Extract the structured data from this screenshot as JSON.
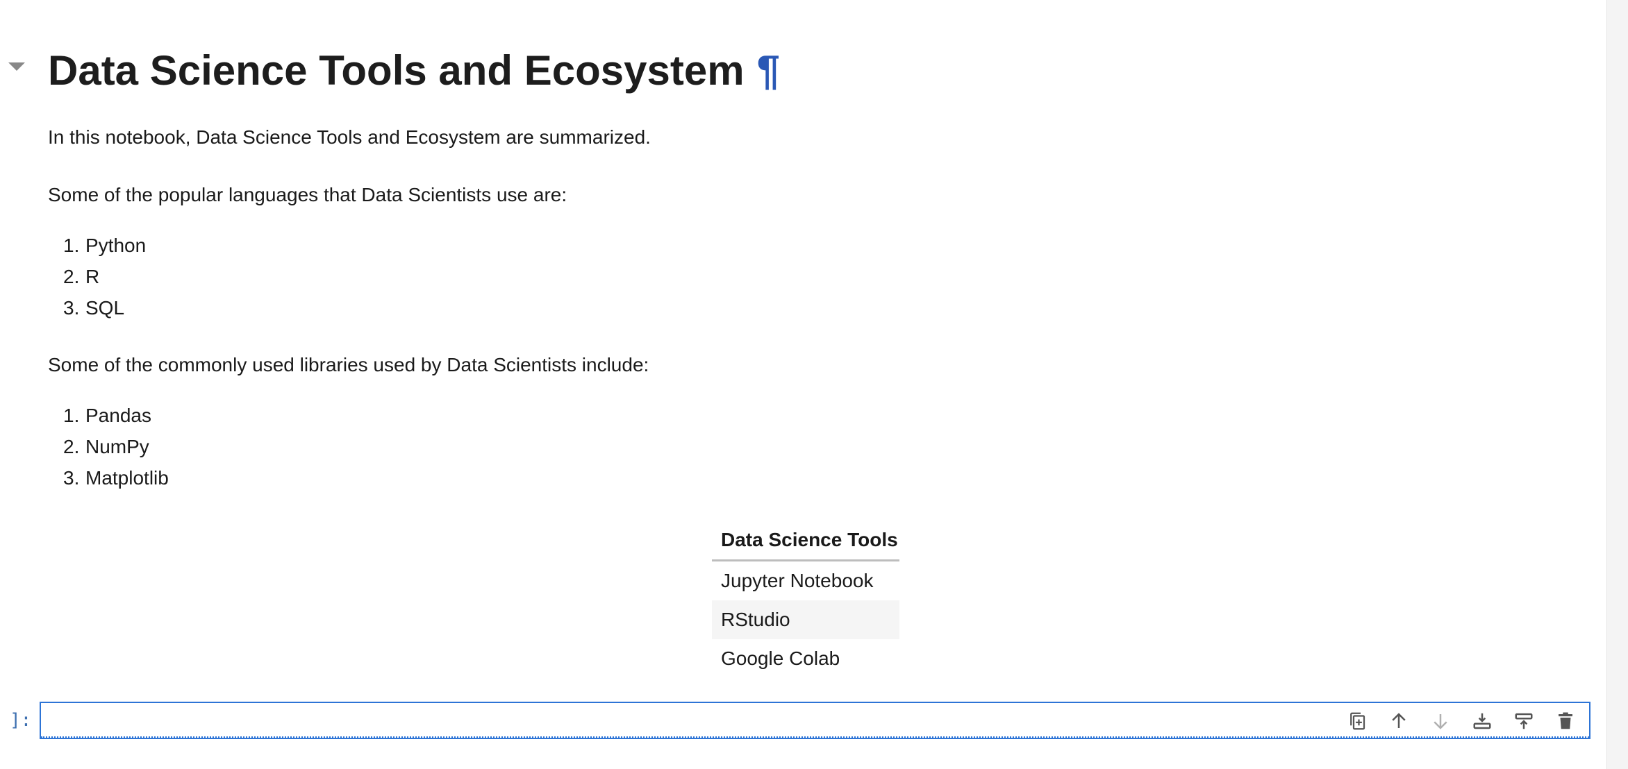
{
  "notebook": {
    "heading": {
      "text": "Data Science Tools and Ecosystem",
      "anchor": "¶"
    },
    "intro": "In this notebook, Data Science Tools and Ecosystem are summarized.",
    "languages_intro": "Some of the popular languages that Data Scientists use are:",
    "languages": [
      {
        "num": "1.",
        "label": "Python"
      },
      {
        "num": "2.",
        "label": "R"
      },
      {
        "num": "3.",
        "label": "SQL"
      }
    ],
    "libraries_intro": "Some of the commonly used libraries used by Data Scientists include:",
    "libraries": [
      {
        "num": "1.",
        "label": "Pandas"
      },
      {
        "num": "2.",
        "label": "NumPy"
      },
      {
        "num": "3.",
        "label": "Matplotlib"
      }
    ],
    "tools_table": {
      "header": "Data Science Tools",
      "rows": [
        "Jupyter Notebook",
        "RStudio",
        "Google Colab"
      ]
    },
    "code_cell": {
      "prompt": "]:",
      "toolbar": [
        {
          "name": "duplicate-cell-icon"
        },
        {
          "name": "move-up-icon"
        },
        {
          "name": "move-down-icon"
        },
        {
          "name": "insert-below-icon"
        },
        {
          "name": "insert-above-icon"
        },
        {
          "name": "delete-icon"
        }
      ]
    }
  },
  "colors": {
    "accent": "#2d74d6",
    "anchor": "#2a58b5",
    "prompt": "#3d6fb0",
    "icon": "#555555",
    "icon_disabled": "#b0b0b0"
  }
}
